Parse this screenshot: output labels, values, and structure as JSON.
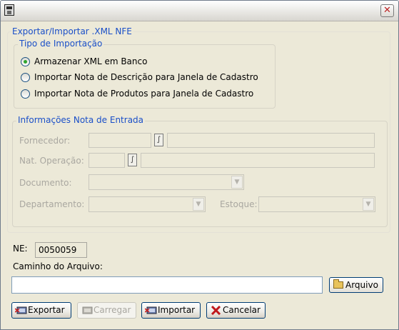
{
  "window": {
    "title": ""
  },
  "main_group": {
    "legend": "Exportar/Importar .XML NFE"
  },
  "import_type": {
    "legend": "Tipo de Importação",
    "options": [
      {
        "label": "Armazenar XML em Banco",
        "checked": true
      },
      {
        "label": "Importar Nota de Descrição para Janela de Cadastro",
        "checked": false
      },
      {
        "label": "Importar Nota de Produtos para Janela de Cadastro",
        "checked": false
      }
    ]
  },
  "entry_info": {
    "legend": "Informações Nota de Entrada",
    "fornecedor_label": "Fornecedor:",
    "nat_operacao_label": "Nat. Operação:",
    "documento_label": "Documento:",
    "departamento_label": "Departamento:",
    "estoque_label": "Estoque:"
  },
  "ne": {
    "label": "NE:",
    "value": "0050059"
  },
  "file_path": {
    "label": "Caminho do Arquivo:",
    "value": "",
    "browse_label": "Arquivo"
  },
  "actions": {
    "exportar": "Exportar",
    "carregar": "Carregar",
    "importar": "Importar",
    "cancelar": "Cancelar"
  },
  "colors": {
    "accent": "#1a4fc8",
    "disabled_text": "#a9a7a0",
    "window_bg": "#ece9d8"
  }
}
